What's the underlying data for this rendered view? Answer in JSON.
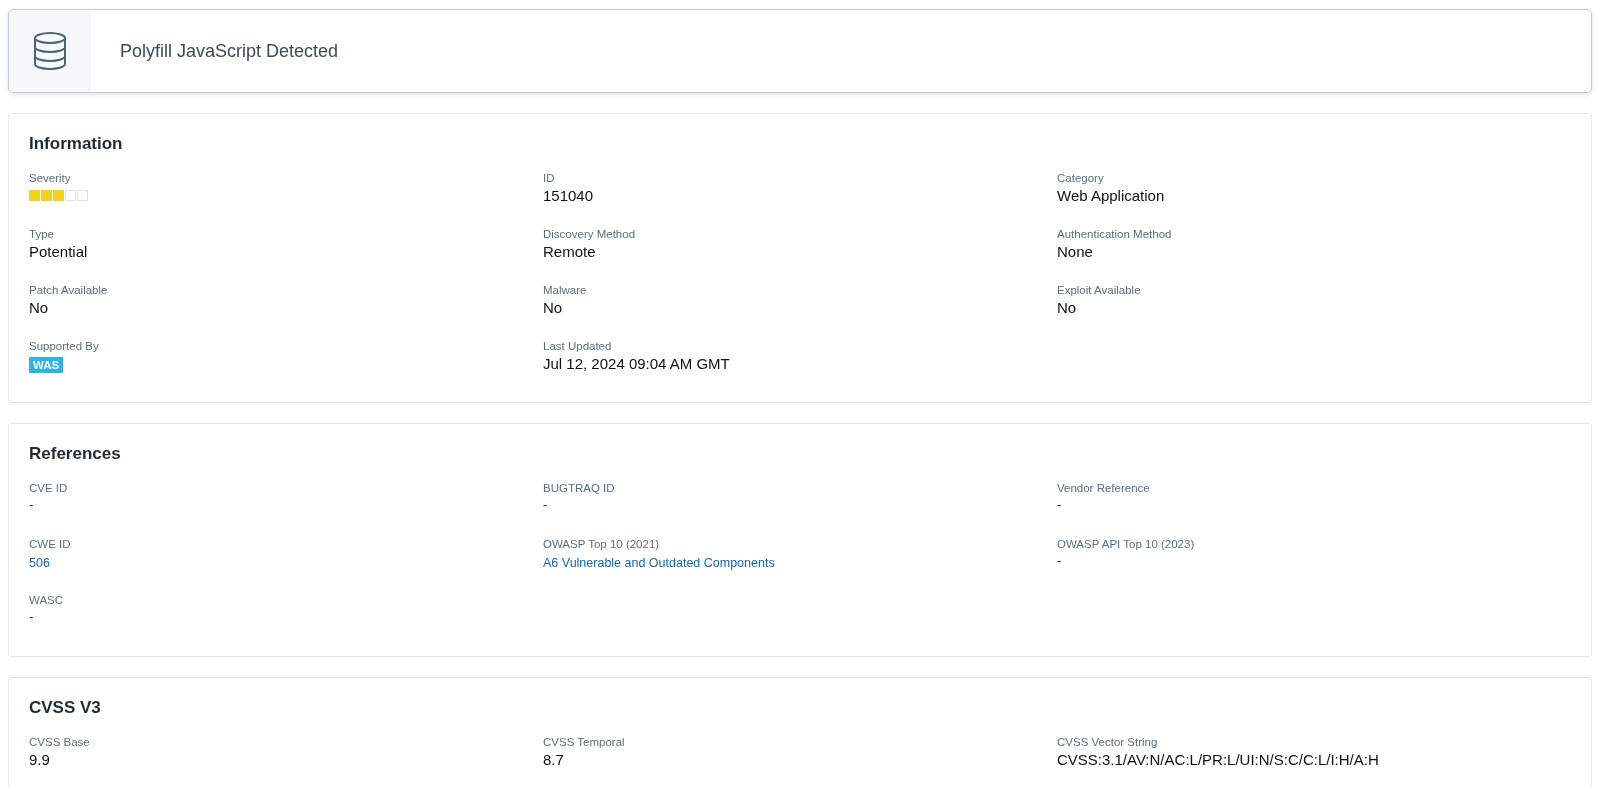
{
  "header": {
    "title": "Polyfill JavaScript Detected"
  },
  "sections": [
    {
      "title": "Information",
      "fields": [
        {
          "label": "Severity",
          "kind": "stars",
          "stars": 3
        },
        {
          "label": "ID",
          "kind": "text",
          "value": "151040"
        },
        {
          "label": "Category",
          "kind": "text",
          "value": "Web Application"
        },
        {
          "label": "Type",
          "kind": "text",
          "value": "Potential"
        },
        {
          "label": "Discovery Method",
          "kind": "text",
          "value": "Remote"
        },
        {
          "label": "Authentication Method",
          "kind": "text",
          "value": "None"
        },
        {
          "label": "Patch Available",
          "kind": "text",
          "value": "No"
        },
        {
          "label": "Malware",
          "kind": "text",
          "value": "No"
        },
        {
          "label": "Exploit Available",
          "kind": "text",
          "value": "No"
        },
        {
          "label": "Supported By",
          "kind": "tag",
          "value": "WAS"
        },
        {
          "label": "Last Updated",
          "kind": "text",
          "value": "Jul 12, 2024 09:04 AM GMT"
        }
      ]
    },
    {
      "title": "References",
      "fields": [
        {
          "label": "CVE ID",
          "kind": "small",
          "value": "-"
        },
        {
          "label": "BUGTRAQ ID",
          "kind": "small",
          "value": "-"
        },
        {
          "label": "Vendor Reference",
          "kind": "small",
          "value": "-"
        },
        {
          "label": "CWE ID",
          "kind": "link",
          "value": "506"
        },
        {
          "label": "OWASP Top 10 (2021)",
          "kind": "link",
          "value": "A6 Vulnerable and Outdated Components"
        },
        {
          "label": "OWASP API Top 10 (2023)",
          "kind": "small",
          "value": "-"
        },
        {
          "label": "WASC",
          "kind": "small",
          "value": "-"
        }
      ]
    },
    {
      "title": "CVSS V3",
      "fields": [
        {
          "label": "CVSS Base",
          "kind": "text",
          "value": "9.9"
        },
        {
          "label": "CVSS Temporal",
          "kind": "text",
          "value": "8.7"
        },
        {
          "label": "CVSS Vector String",
          "kind": "text",
          "value": "CVSS:3.1/AV:N/AC:L/PR:L/UI:N/S:C/C:L/I:H/A:H"
        }
      ]
    }
  ]
}
